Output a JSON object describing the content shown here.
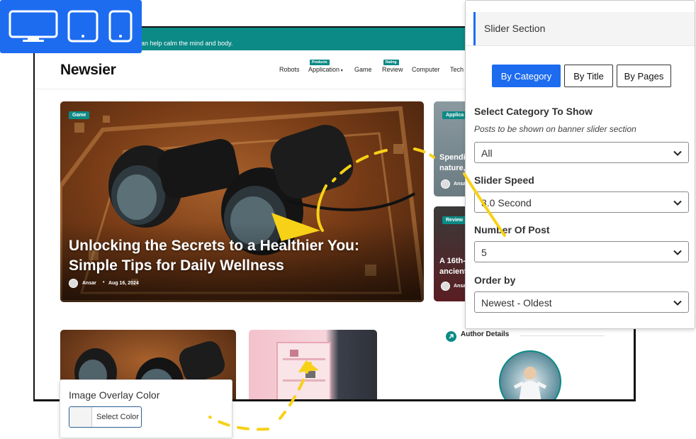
{
  "site": {
    "topbar_text": "an help calm the mind and body.",
    "logo": "Newsier",
    "nav": [
      {
        "label": "Robots",
        "badge": ""
      },
      {
        "label": "Application",
        "badge": "Products",
        "dropdown": true
      },
      {
        "label": "Game",
        "badge": ""
      },
      {
        "label": "Review",
        "badge": "Rating"
      },
      {
        "label": "Computer",
        "badge": ""
      },
      {
        "label": "Tech",
        "badge": ""
      }
    ],
    "hero": {
      "tag": "Game",
      "title": "Unlocking the Secrets to a Healthier You: Simple Tips for Daily Wellness",
      "author": "Ansar",
      "date": "Aug 16, 2024"
    },
    "side_cards": [
      {
        "tag": "Applica",
        "title_line1": "Spendi",
        "title_line2": "nature,",
        "author": "Ansa"
      },
      {
        "tag": "Review",
        "title_line1": "A 16th-c",
        "title_line2": "ancient",
        "author": "Ansa"
      }
    ],
    "author_section": "Author Details"
  },
  "overlay_color": {
    "label": "Image Overlay Color",
    "button_label": "Select Color"
  },
  "panel": {
    "title": "Slider Section",
    "tabs": [
      {
        "label": "By Category",
        "active": true
      },
      {
        "label": "By Title",
        "active": false
      },
      {
        "label": "By Pages",
        "active": false
      }
    ],
    "fields": [
      {
        "label": "Select Category To Show",
        "description": "Posts to be shown on banner slider section",
        "value": "All"
      },
      {
        "label": "Slider Speed",
        "description": "",
        "value": "3.0 Second"
      },
      {
        "label": "Number Of Post",
        "description": "",
        "value": "5"
      },
      {
        "label": "Order by",
        "description": "",
        "value": "Newest - Oldest"
      }
    ]
  },
  "colors": {
    "accent": "#1d6cf0",
    "teal": "#0c8a86",
    "doodle": "#f7d117"
  },
  "icons": [
    "desktop-icon",
    "tablet-icon",
    "mobile-icon",
    "chevron-down-icon"
  ]
}
